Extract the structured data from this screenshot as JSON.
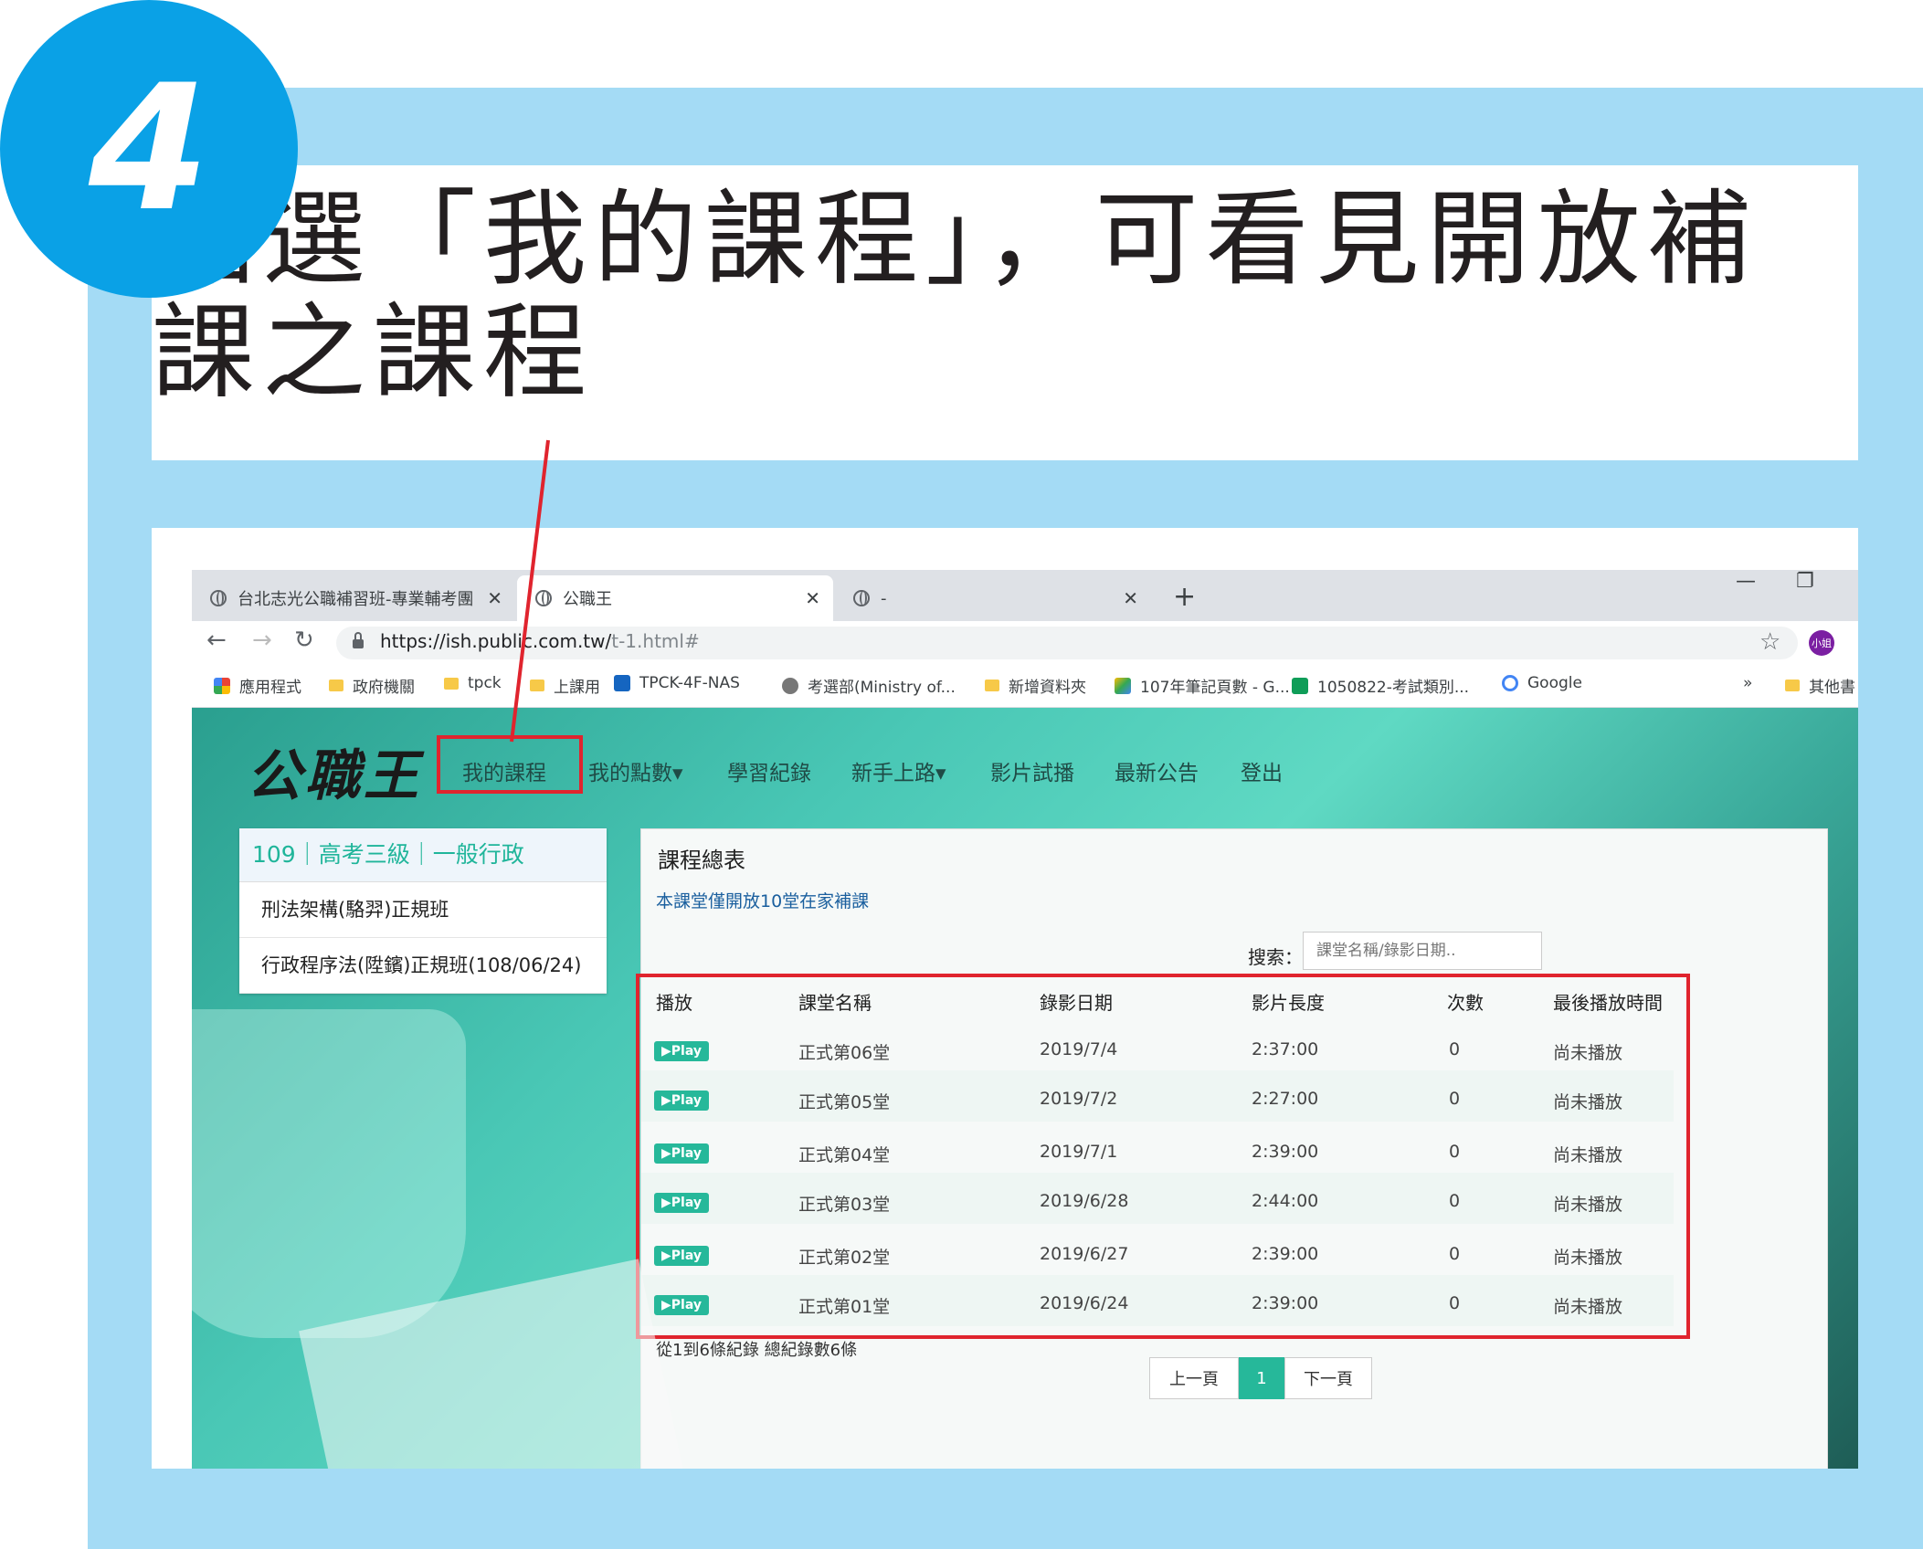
{
  "step": {
    "number": "4"
  },
  "instruction": {
    "line1": "點選「我的課程」，可看見開放補",
    "line2": "課之課程"
  },
  "browser": {
    "tabs": [
      {
        "label": "台北志光公職補習班-專業輔考團"
      },
      {
        "label": "公職王"
      },
      {
        "label": "-"
      }
    ],
    "url_host": "https://ish.public.com.tw/",
    "url_path": "t-1.html#",
    "profile": "小姐",
    "bookmarks": [
      {
        "label": "應用程式",
        "icon": "apps-grid-icon"
      },
      {
        "label": "政府機關",
        "icon": "folder-icon"
      },
      {
        "label": "tpck",
        "icon": "folder-icon"
      },
      {
        "label": "上課用",
        "icon": "folder-icon"
      },
      {
        "label": "TPCK-4F-NAS",
        "icon": "nas-icon"
      },
      {
        "label": "考選部(Ministry of...",
        "icon": "ministry-icon"
      },
      {
        "label": "新增資料夾",
        "icon": "folder-icon"
      },
      {
        "label": "107年筆記頁數 - G...",
        "icon": "google-drive-icon"
      },
      {
        "label": "1050822-考試類別...",
        "icon": "google-sheets-icon"
      },
      {
        "label": "Google",
        "icon": "google-icon"
      },
      {
        "label": "»",
        "icon": "more-chevron-icon"
      },
      {
        "label": "其他書",
        "icon": "folder-icon"
      }
    ]
  },
  "site": {
    "logo": "公職王",
    "nav": [
      "我的課程",
      "我的點數▾",
      "學習紀錄",
      "新手上路▾",
      "影片試播",
      "最新公告",
      "登出"
    ],
    "sidebar": {
      "header": "109｜高考三級｜一般行政",
      "items": [
        "刑法架構(駱羿)正規班",
        "行政程序法(陞鑌)正規班(108/06/24)"
      ]
    },
    "panel": {
      "title": "課程總表",
      "notice": "本課堂僅開放10堂在家補課",
      "search_label": "搜索：",
      "search_placeholder": "課堂名稱/錄影日期..",
      "columns": [
        "播放",
        "課堂名稱",
        "錄影日期",
        "影片長度",
        "次數",
        "最後播放時間"
      ],
      "play_label": "Play",
      "rows": [
        {
          "name": "正式第06堂",
          "date": "2019/7/4",
          "length": "2:37:00",
          "count": "0",
          "last": "尚未播放"
        },
        {
          "name": "正式第05堂",
          "date": "2019/7/2",
          "length": "2:27:00",
          "count": "0",
          "last": "尚未播放"
        },
        {
          "name": "正式第04堂",
          "date": "2019/7/1",
          "length": "2:39:00",
          "count": "0",
          "last": "尚未播放"
        },
        {
          "name": "正式第03堂",
          "date": "2019/6/28",
          "length": "2:44:00",
          "count": "0",
          "last": "尚未播放"
        },
        {
          "name": "正式第02堂",
          "date": "2019/6/27",
          "length": "2:39:00",
          "count": "0",
          "last": "尚未播放"
        },
        {
          "name": "正式第01堂",
          "date": "2019/6/24",
          "length": "2:39:00",
          "count": "0",
          "last": "尚未播放"
        }
      ],
      "records_info": "從1到6條紀錄  總紀錄數6條",
      "pager": {
        "prev": "上一頁",
        "current": "1",
        "next": "下一頁"
      }
    }
  },
  "colors": {
    "frame": "#a4dbf5",
    "step_circle": "#0aa1e6",
    "highlight": "#e0242e",
    "accent": "#26b89a"
  }
}
